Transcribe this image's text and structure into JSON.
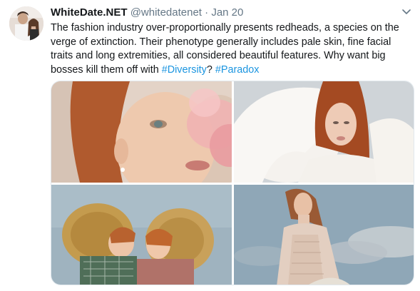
{
  "tweet": {
    "author_name": "WhiteDate.NET",
    "handle": "@whitedatenet",
    "separator": "·",
    "date": "Jan 20",
    "text_main": "The fashion industry over-proportionally presents redheads, a species on the verge of extinction. Their phenotype generally includes pale skin, fine facial traits and long extremities, all considered beautiful features. Why want big bosses kill them off with ",
    "hashtag_1": "#Diversity",
    "text_between": "? ",
    "hashtag_2": "#Paradox"
  },
  "icons": {
    "menu": "chevron-down-icon"
  },
  "colors": {
    "link": "#1b95e0",
    "secondary_text": "#657786",
    "primary_text": "#14171a"
  }
}
